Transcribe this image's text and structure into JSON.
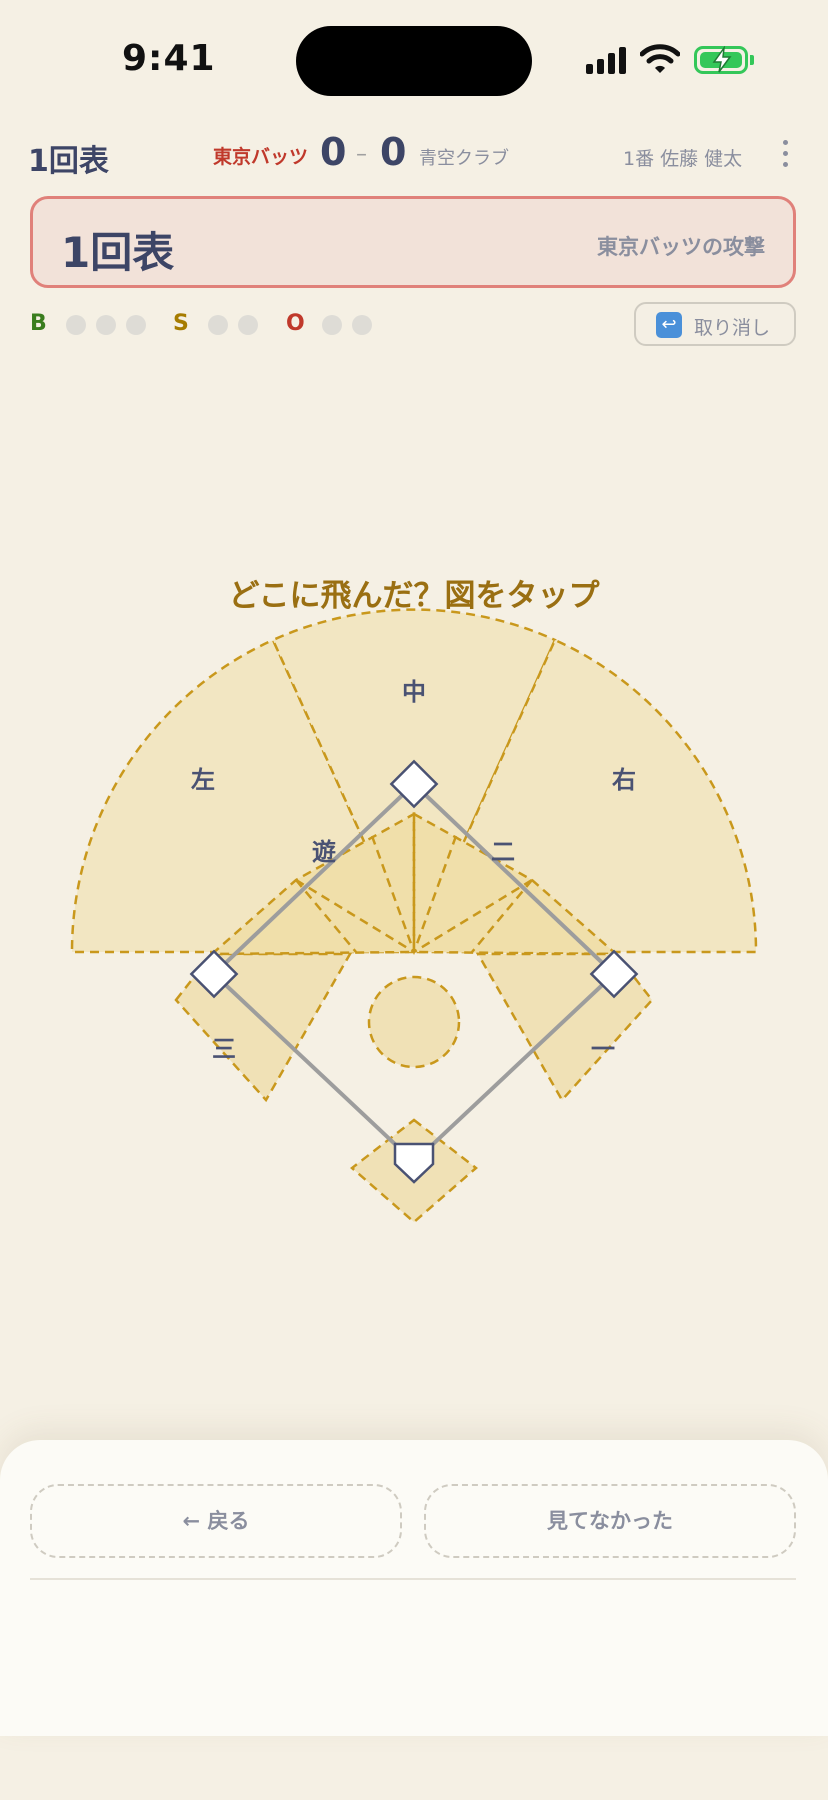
{
  "status_bar": {
    "time": "9:41"
  },
  "header": {
    "inning": "1回表",
    "home_team": "東京バッツ",
    "home_score": "0",
    "separator": "–",
    "away_score": "0",
    "away_team": "青空クラブ",
    "batter": "1番 佐藤 健太"
  },
  "banner": {
    "inning": "1回表",
    "attack": "東京バッツの攻撃"
  },
  "count": {
    "balls_label": "B",
    "strikes_label": "S",
    "outs_label": "O",
    "balls": 0,
    "strikes": 0,
    "outs": 0,
    "colors": {
      "balls": "#3a7d1e",
      "strikes": "#a67c00",
      "outs": "#c0392b"
    }
  },
  "undo": {
    "label": "取り消し",
    "icon": "undo-arrow-icon"
  },
  "prompt": "どこに飛んだ？図をタップ",
  "field": {
    "zones": {
      "left": "左",
      "center": "中",
      "right": "右",
      "shortstop": "遊",
      "second": "二",
      "third": "三",
      "first": "一"
    },
    "colors": {
      "zone_fill": "#f3e6bf",
      "zone_stroke": "#c9981c",
      "basepath": "#9d9d9d"
    }
  },
  "bottom": {
    "back_label": "← 戻る",
    "not_seen_label": "見てなかった"
  }
}
